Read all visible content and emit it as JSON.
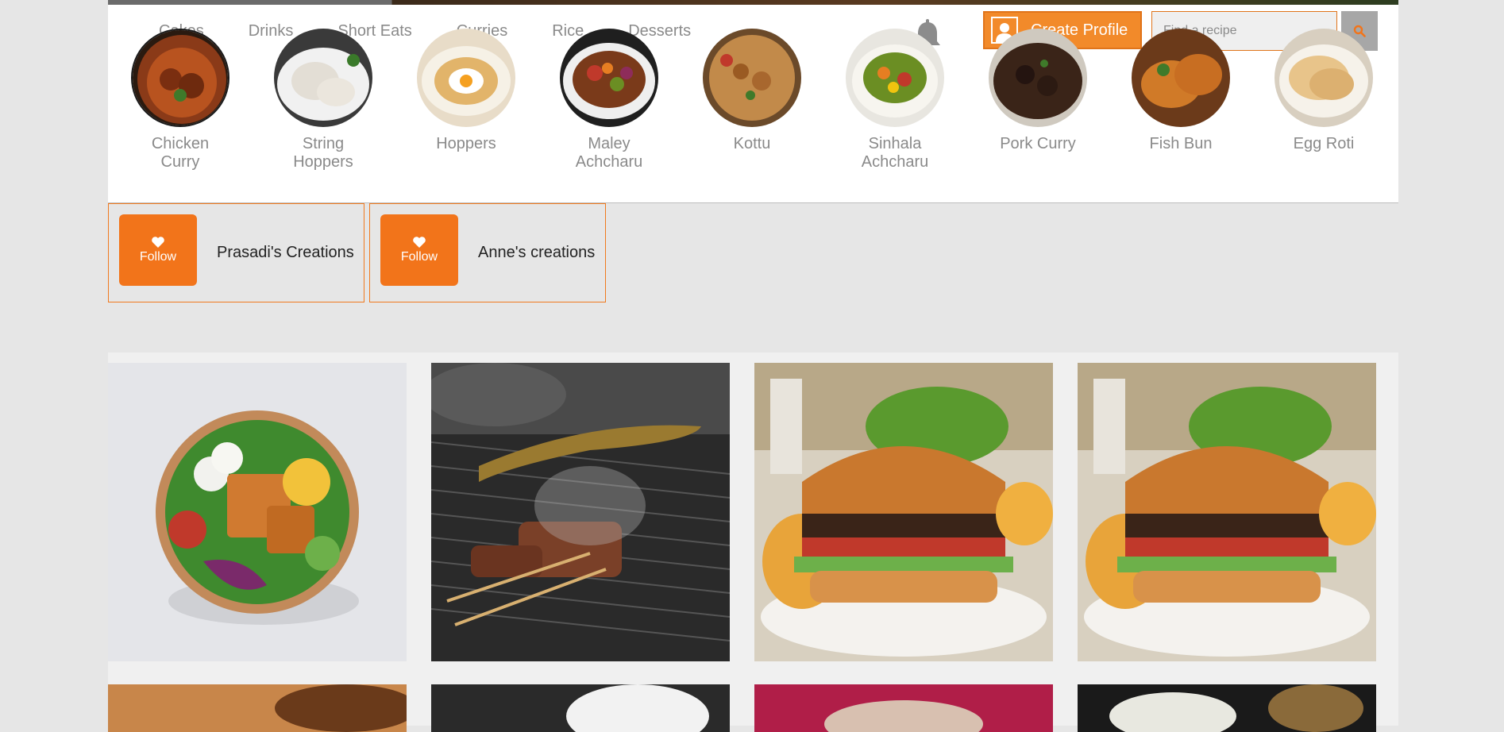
{
  "nav": {
    "links": [
      "Cakes",
      "Drinks",
      "Short Eats",
      "Curries",
      "Rice",
      "Desserts"
    ]
  },
  "header": {
    "create_profile_label": "Create Profile",
    "search_placeholder": "Find a recipe",
    "accent": "#f28a2a"
  },
  "categories": [
    {
      "label_line1": "Chicken",
      "label_line2": "Curry"
    },
    {
      "label_line1": "String",
      "label_line2": "Hoppers"
    },
    {
      "label_line1": "Hoppers",
      "label_line2": ""
    },
    {
      "label_line1": "Maley",
      "label_line2": "Achcharu"
    },
    {
      "label_line1": "Kottu",
      "label_line2": ""
    },
    {
      "label_line1": "Sinhala",
      "label_line2": "Achcharu"
    },
    {
      "label_line1": "Pork Curry",
      "label_line2": ""
    },
    {
      "label_line1": "Fish Bun",
      "label_line2": ""
    },
    {
      "label_line1": "Egg Roti",
      "label_line2": ""
    }
  ],
  "creators": [
    {
      "follow_label": "Follow",
      "name": "Prasadi's Creations"
    },
    {
      "follow_label": "Follow",
      "name": "Anne's creations"
    }
  ],
  "icons": [
    "bell-icon",
    "user-avatar-icon",
    "search-icon",
    "heart-icon"
  ]
}
